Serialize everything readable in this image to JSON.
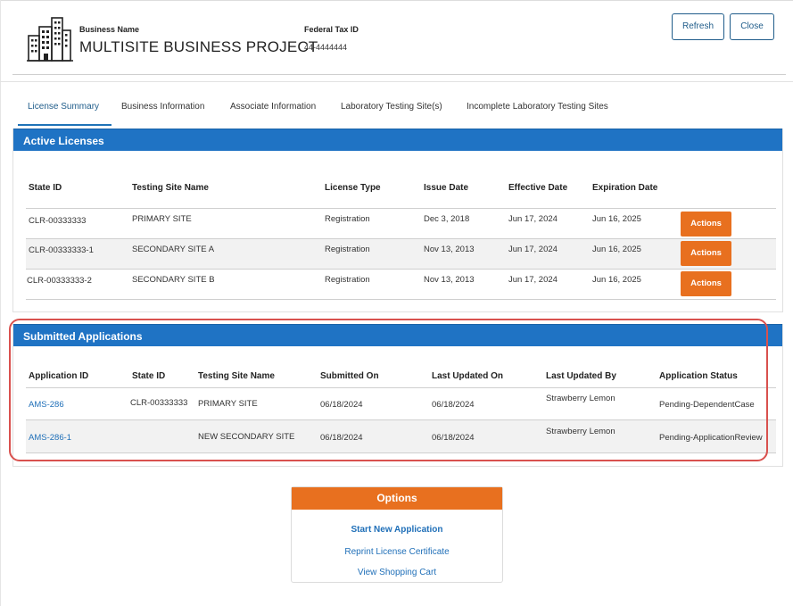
{
  "header": {
    "business_name_label": "Business Name",
    "business_name": "MULTISITE BUSINESS PROJECT",
    "tax_id_label": "Federal Tax ID",
    "tax_id": "44-4444444",
    "refresh_label": "Refresh",
    "close_label": "Close"
  },
  "tabs": [
    {
      "label": "License Summary",
      "active": true
    },
    {
      "label": "Business Information"
    },
    {
      "label": "Associate Information"
    },
    {
      "label": "Laboratory Testing Site(s)"
    },
    {
      "label": "Incomplete Laboratory Testing Sites"
    }
  ],
  "active_licenses": {
    "title": "Active Licenses",
    "columns": [
      "State ID",
      "Testing Site Name",
      "License Type",
      "Issue Date",
      "Effective Date",
      "Expiration Date"
    ],
    "action_label": "Actions",
    "rows": [
      {
        "state_id": "CLR-00333333",
        "site": "PRIMARY SITE",
        "type": "Registration",
        "issue": "Dec 3, 2018",
        "effective": "Jun 17, 2024",
        "expiration": "Jun 16, 2025"
      },
      {
        "state_id": "CLR-00333333-1",
        "site": "SECONDARY SITE A",
        "type": "Registration",
        "issue": "Nov 13, 2013",
        "effective": "Jun 17, 2024",
        "expiration": "Jun 16, 2025"
      },
      {
        "state_id": "CLR-00333333-2",
        "site": "SECONDARY SITE B",
        "type": "Registration",
        "issue": "Nov 13, 2013",
        "effective": "Jun 17, 2024",
        "expiration": "Jun 16, 2025"
      }
    ]
  },
  "submitted_applications": {
    "title": "Submitted Applications",
    "columns": [
      "Application ID",
      "State ID",
      "Testing Site Name",
      "Submitted On",
      "Last Updated On",
      "Last Updated By",
      "Application Status"
    ],
    "rows": [
      {
        "app_id": "AMS-286",
        "state_id": "CLR-00333333",
        "site": "PRIMARY SITE",
        "submitted": "06/18/2024",
        "updated": "06/18/2024",
        "updated_by": "Strawberry Lemon",
        "status": "Pending-DependentCase"
      },
      {
        "app_id": "AMS-286-1",
        "state_id": "",
        "site": "NEW SECONDARY SITE",
        "submitted": "06/18/2024",
        "updated": "06/18/2024",
        "updated_by": "Strawberry Lemon",
        "status": "Pending-ApplicationReview"
      }
    ]
  },
  "options": {
    "title": "Options",
    "start_new": "Start New Application",
    "reprint": "Reprint License Certificate",
    "cart": "View Shopping Cart"
  },
  "colors": {
    "primary_blue": "#1f73c4",
    "accent_orange": "#e8701f",
    "link_blue": "#1f6fb8",
    "highlight_red": "#d9514e"
  }
}
